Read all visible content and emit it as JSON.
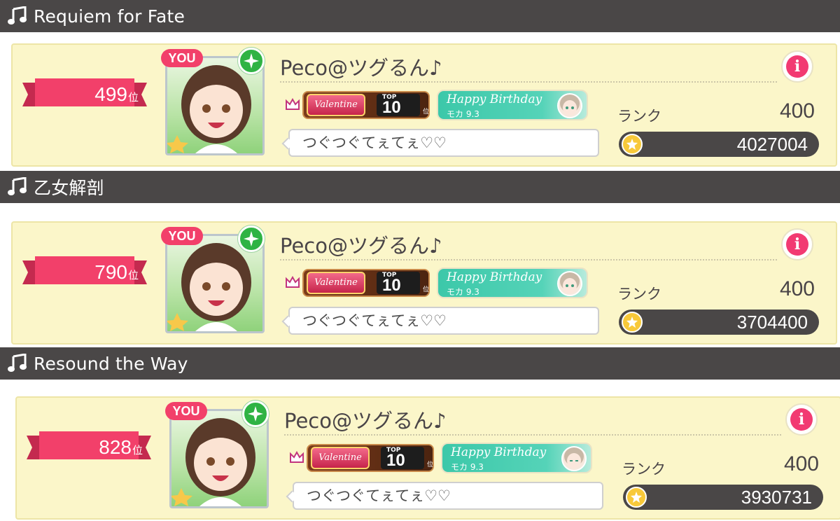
{
  "colors": {
    "header_bg": "#4a4747",
    "card_bg": "#fbf6c9",
    "ribbon": "#f2406a",
    "info_button": "#f23a72",
    "attribute_green": "#2fb344",
    "birthday_teal": "#3cc8a9"
  },
  "entries": [
    {
      "song_title": "Requiem for Fate",
      "rank": "499",
      "rank_unit": "位",
      "you_tag": "YOU",
      "player_name": "Peco@ツグるん♪",
      "valentine_badge": "Valentine",
      "top_label": "TOP",
      "top_value": "10",
      "top_unit": "位",
      "birthday_title": "Happy Birthday",
      "birthday_sub": "モカ 9.3",
      "comment": "つぐつぐてぇてぇ♡♡",
      "rank_label": "ランク",
      "player_rank": "400",
      "score": "4027004"
    },
    {
      "song_title": "乙女解剖",
      "rank": "790",
      "rank_unit": "位",
      "you_tag": "YOU",
      "player_name": "Peco@ツグるん♪",
      "valentine_badge": "Valentine",
      "top_label": "TOP",
      "top_value": "10",
      "top_unit": "位",
      "birthday_title": "Happy Birthday",
      "birthday_sub": "モカ 9.3",
      "comment": "つぐつぐてぇてぇ♡♡",
      "rank_label": "ランク",
      "player_rank": "400",
      "score": "3704400"
    },
    {
      "song_title": "Resound the Way",
      "rank": "828",
      "rank_unit": "位",
      "you_tag": "YOU",
      "player_name": "Peco@ツグるん♪",
      "valentine_badge": "Valentine",
      "top_label": "TOP",
      "top_value": "10",
      "top_unit": "位",
      "birthday_title": "Happy Birthday",
      "birthday_sub": "モカ 9.3",
      "comment": "つぐつぐてぇてぇ♡♡",
      "rank_label": "ランク",
      "player_rank": "400",
      "score": "3930731"
    }
  ]
}
